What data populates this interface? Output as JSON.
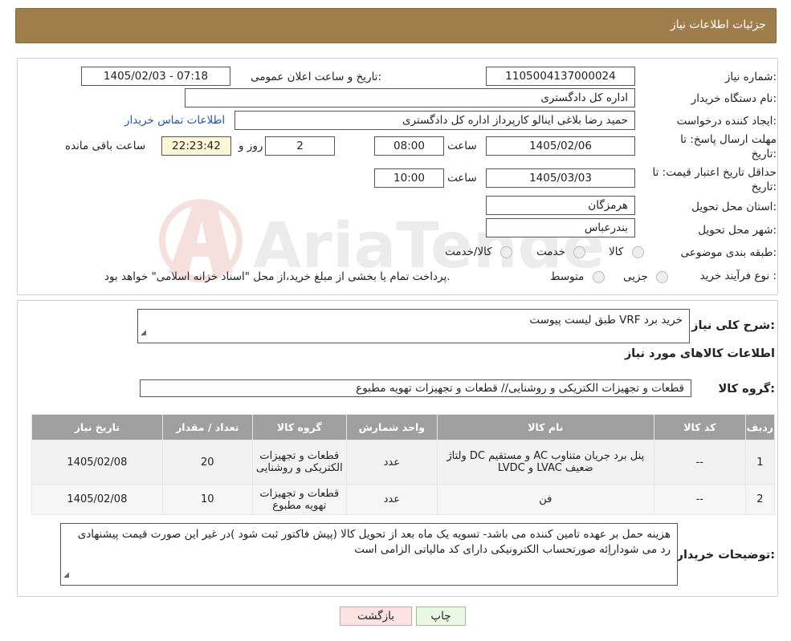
{
  "header": {
    "title": "جزئیات اطلاعات نیاز"
  },
  "form": {
    "need_number_label": "شماره نیاز:",
    "need_number": "1105004137000024",
    "announce_label": "تاریخ و ساعت اعلان عمومی:",
    "announce_value": "1405/02/03 - 07:18",
    "buyer_org_label": "نام دستگاه خریدار:",
    "buyer_org": "اداره کل دادگستری",
    "requester_label": "ایجاد کننده درخواست:",
    "requester": "حمید رضا  بلاغی اینالو کارپرداز اداره کل دادگستری",
    "contact_link": "اطلاعات تماس خریدار",
    "deadline_label_1": "مهلت ارسال پاسخ: تا",
    "deadline_label_2": "تاریخ:",
    "deadline_date": "1405/02/06",
    "time_label": "ساعت",
    "deadline_time": "08:00",
    "days_value": "2",
    "days_label": "روز و",
    "remaining_time": "22:23:42",
    "remaining_label": "ساعت باقی مانده",
    "validity_label_1": "حداقل تاریخ اعتبار قیمت: تا",
    "validity_label_2": "تاریخ:",
    "validity_date": "1405/03/03",
    "validity_time": "10:00",
    "province_label": "استان محل تحویل:",
    "province": "هرمزگان",
    "city_label": "شهر محل تحویل:",
    "city": "بندرعباس",
    "category_label": "طبقه بندی موضوعی:",
    "category_options": [
      "کالا",
      "خدمت",
      "کالا/خدمت"
    ],
    "process_label": "نوع فرآیند خرید :",
    "process_options": [
      "جزیی",
      "متوسط"
    ],
    "process_note": "پرداخت تمام یا بخشی از مبلغ خرید،از محل \"اسناد خزانه اسلامی\" خواهد بود."
  },
  "details": {
    "summary_label": "شرح کلی نیاز:",
    "summary": "خرید برد VRF طبق لیست پیوست",
    "items_title": "اطلاعات کالاهای مورد نیاز",
    "group_label": "گروه کالا:",
    "group_value": "قطعات و تجهیزات الکتریکی و روشنایی//  قطعات و تجهیزات تهویه مطبوع"
  },
  "table": {
    "headers": [
      "ردیف",
      "کد کالا",
      "نام کالا",
      "واحد شمارش",
      "گروه کالا",
      "تعداد / مقدار",
      "تاریخ نیاز"
    ],
    "rows": [
      {
        "row": "1",
        "code": "--",
        "name": "پنل برد جریان متناوب AC و مستقیم DC ولتاژ ضعیف LVAC و LVDC",
        "unit": "عدد",
        "group": "قطعات و تجهیزات الکتریکی و روشنایی",
        "qty": "20",
        "date": "1405/02/08"
      },
      {
        "row": "2",
        "code": "--",
        "name": "فن",
        "unit": "عدد",
        "group": "قطعات و تجهیزات تهویه مطبوع",
        "qty": "10",
        "date": "1405/02/08"
      }
    ]
  },
  "buyer_notes": {
    "label": "توضیحات خریدار:",
    "text": "هزینه حمل بر عهده تامین کننده می باشد- تسویه یک ماه بعد از تحویل کالا (پیش فاکتور ثبت شود )در غیر این صورت قیمت پیشنهادی رد می شوداراِئه صورتحساب الکترونیکی دارای کد مالیاتی الزامی است"
  },
  "buttons": {
    "print": "چاپ",
    "back": "بازگشت"
  },
  "watermark": {
    "text": "AriaTender.neT"
  }
}
